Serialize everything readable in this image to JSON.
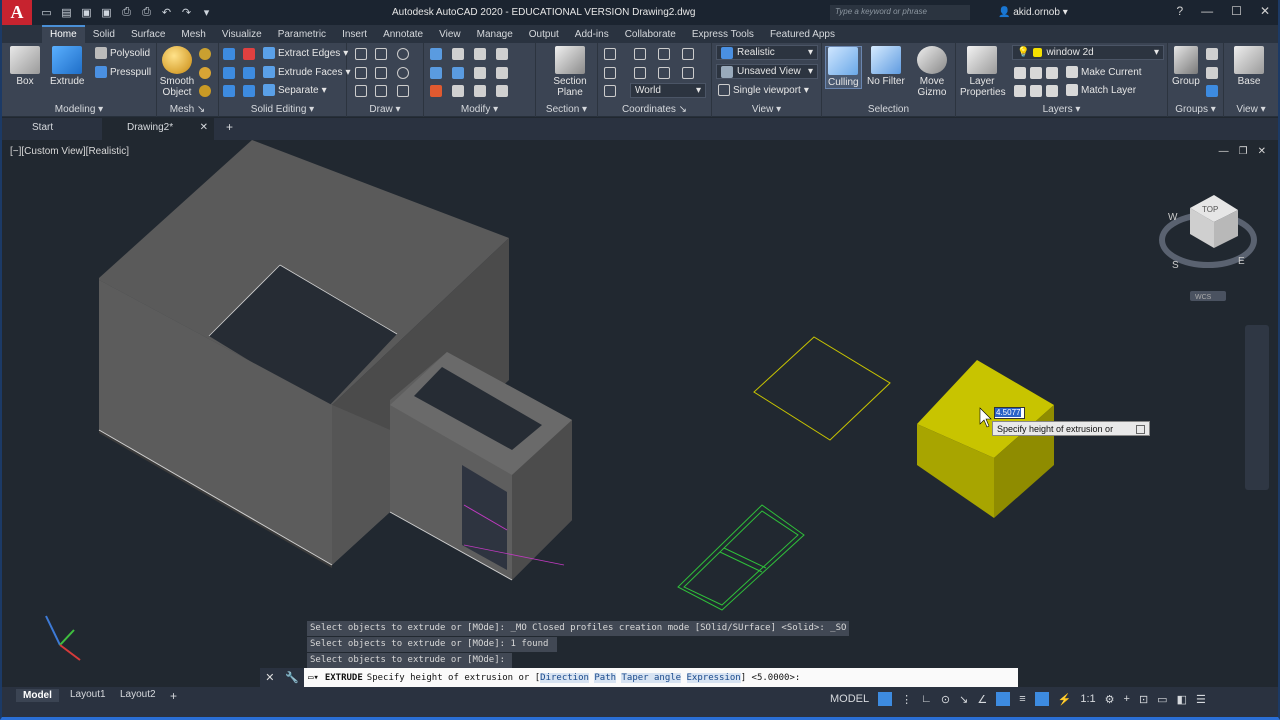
{
  "window": {
    "title": "Autodesk AutoCAD 2020 - EDUCATIONAL VERSION    Drawing2.dwg",
    "search_placeholder": "Type a keyword or phrase",
    "user": "akid.ornob",
    "logo_letter": "A"
  },
  "ribbon_tabs": [
    "Home",
    "Solid",
    "Surface",
    "Mesh",
    "Visualize",
    "Parametric",
    "Insert",
    "Annotate",
    "View",
    "Manage",
    "Output",
    "Add-ins",
    "Collaborate",
    "Express Tools",
    "Featured Apps"
  ],
  "panels": {
    "modeling": {
      "title": "Modeling",
      "box": "Box",
      "extrude": "Extrude",
      "polysolid": "Polysolid",
      "presspull": "Presspull"
    },
    "mesh": {
      "title": "Mesh",
      "smooth": "Smooth Object"
    },
    "solid_editing": {
      "title": "Solid Editing",
      "extract_edges": "Extract Edges",
      "extrude_faces": "Extrude Faces",
      "separate": "Separate"
    },
    "draw": {
      "title": "Draw"
    },
    "modify": {
      "title": "Modify"
    },
    "section": {
      "title": "Section",
      "section_plane": "Section Plane"
    },
    "coordinates": {
      "title": "Coordinates",
      "world": "World"
    },
    "view": {
      "title": "View",
      "visual_style": "Realistic",
      "named_view": "Unsaved View",
      "viewport": "Single viewport"
    },
    "selection": {
      "title": "Selection",
      "culling": "Culling",
      "no_filter": "No Filter",
      "move_gizmo": "Move Gizmo"
    },
    "layers": {
      "title": "Layers",
      "layer_properties": "Layer Properties",
      "current_layer": "window 2d",
      "make_current": "Make Current",
      "match_layer": "Match Layer"
    },
    "groups": {
      "title": "Groups",
      "group": "Group"
    },
    "view2": {
      "title": "View",
      "base": "Base"
    }
  },
  "file_tabs": {
    "start": "Start",
    "drawing": "Drawing2*"
  },
  "viewport": {
    "label": "[−][Custom View][Realistic]",
    "viewcube": {
      "top": "TOP",
      "s": "S",
      "e": "E",
      "w": "W",
      "wcs": "WCS"
    }
  },
  "dynamic_input": {
    "value": "4.5077",
    "prompt": "Specify height of extrusion or"
  },
  "command_history": [
    "Select objects to extrude or [MOde]: _MO Closed profiles creation mode [SOlid/SUrface] <Solid>: _SO",
    "Select objects to extrude or [MOde]: 1 found",
    "Select objects to extrude or [MOde]:"
  ],
  "command_line": {
    "command": "EXTRUDE",
    "prompt": "Specify height of extrusion or [",
    "options": [
      "Direction",
      "Path",
      "Taper angle",
      "Expression"
    ],
    "suffix": "] <5.0000>:"
  },
  "layout_tabs": [
    "Model",
    "Layout1",
    "Layout2"
  ],
  "status": {
    "model": "MODEL",
    "scale": "1:1"
  },
  "colors": {
    "cube": "#c8c400",
    "green_profile": "#2fbf3a",
    "yellow_profile": "#c8c400",
    "walls": "#5e5e5e"
  }
}
